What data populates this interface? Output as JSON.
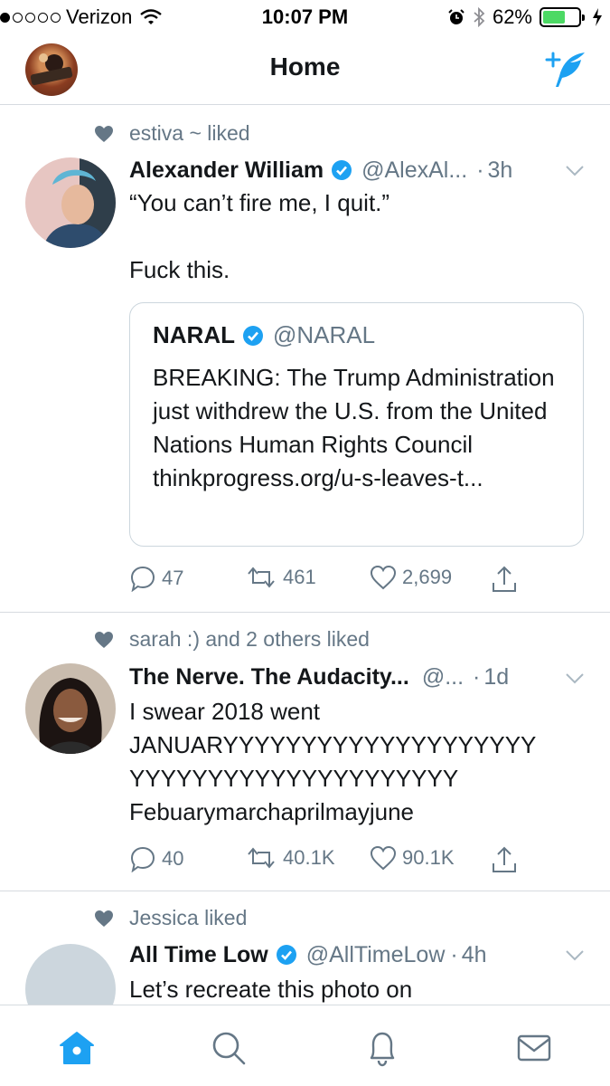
{
  "status_bar": {
    "carrier": "Verizon",
    "time": "10:07 PM",
    "battery": "62%",
    "battery_level": 0.62,
    "signal_bars_filled": 1,
    "signal_bars_total": 5
  },
  "nav": {
    "title": "Home"
  },
  "colors": {
    "accent": "#1da1f2",
    "muted": "#657786",
    "border": "#d6dbe0"
  },
  "tweets": [
    {
      "social": "estiva ~ liked",
      "name": "Alexander William",
      "handle": "@AlexAl...",
      "time": "3h",
      "text": "“You can’t fire me, I quit.”\n\nFuck this.",
      "quote": {
        "name": "NARAL",
        "handle": "@NARAL",
        "text": "BREAKING: The Trump Administration just withdrew the U.S. from the United Nations Human Rights Council thinkprogress.org/u-s-leaves-t..."
      },
      "replies": "47",
      "retweets": "461",
      "likes": "2,699"
    },
    {
      "social": "sarah :) and 2 others liked",
      "name": "The Nerve. The Audacity...",
      "handle": "@...",
      "time": "1d",
      "text": "I swear 2018 went\nJANUARYYYYYYYYYYYYYYYYYYYY\nYYYYYYYYYYYYYYYYYYYYY\nFebuarymarchaprilmayjune",
      "replies": "40",
      "retweets": "40.1K",
      "likes": "90.1K"
    },
    {
      "social": "Jessica liked",
      "name": "All Time Low",
      "handle": "@AllTimeLow",
      "time": "4h",
      "text": "Let’s recreate this photo on"
    }
  ]
}
